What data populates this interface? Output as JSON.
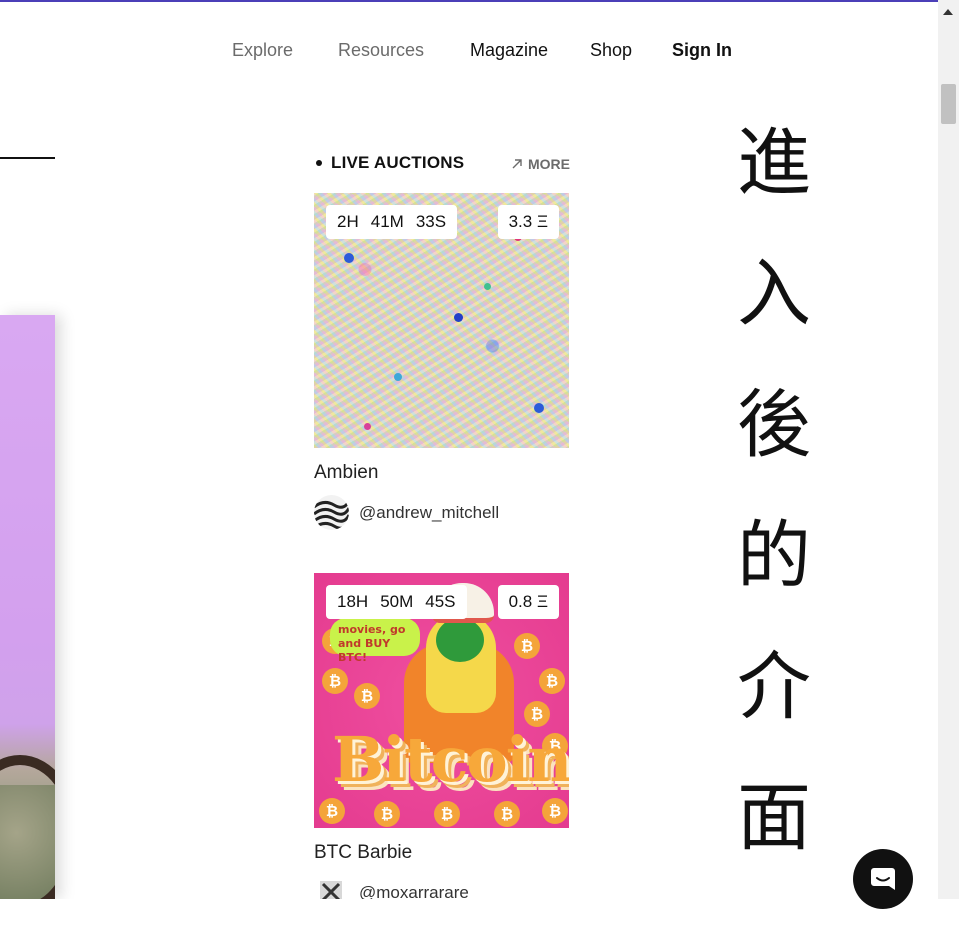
{
  "nav": {
    "explore": "Explore",
    "resources": "Resources",
    "magazine": "Magazine",
    "shop": "Shop",
    "sign_in": "Sign In"
  },
  "live_auctions": {
    "title": "LIVE AUCTIONS",
    "more": "MORE",
    "items": [
      {
        "hours": "2H",
        "minutes": "41M",
        "seconds": "33S",
        "price": "3.3 Ξ",
        "title": "Ambien",
        "creator": "@andrew_mitchell"
      },
      {
        "hours": "18H",
        "minutes": "50M",
        "seconds": "45S",
        "price": "0.8 Ξ",
        "title": "BTC Barbie",
        "creator": "@moxarrarare",
        "art_text": "Bitcoin",
        "speech_text": "movies, go and BUY BTC!"
      }
    ]
  },
  "vertical_text": "進入後的介面",
  "colors": {
    "accent_top": "#4b3fb8",
    "bitcoin_orange": "#f4a43a",
    "barbie_pink": "#e43b8f"
  },
  "icons": {
    "more": "arrow-up-right-icon",
    "chat": "chat-icon",
    "scroll_up": "scroll-up-icon"
  }
}
